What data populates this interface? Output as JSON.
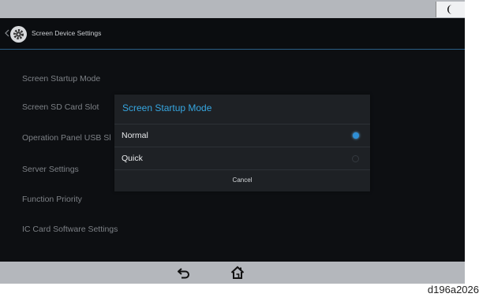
{
  "header": {
    "title": "Screen Device Settings"
  },
  "menu": {
    "items": [
      {
        "label": "Screen Startup Mode"
      },
      {
        "label": "Screen SD Card Slot"
      },
      {
        "label": "Operation Panel USB Sl"
      },
      {
        "label": "Server Settings"
      },
      {
        "label": "Function Priority"
      },
      {
        "label": "IC Card Software Settings"
      }
    ]
  },
  "dialog": {
    "title": "Screen Startup Mode",
    "options": [
      {
        "label": "Normal",
        "selected": true
      },
      {
        "label": "Quick",
        "selected": false
      }
    ],
    "cancel_label": "Cancel"
  },
  "icons": {
    "status": "moon-icon",
    "header": "gear-icon",
    "nav_back": "back-arrow-icon",
    "nav_home": "home-icon"
  },
  "colors": {
    "accent": "#36a6e0",
    "radio_selected": "#2e8fd6",
    "screen_bg": "#0d0f12",
    "bars": "#b4b7bc"
  },
  "caption": "d196a2026"
}
